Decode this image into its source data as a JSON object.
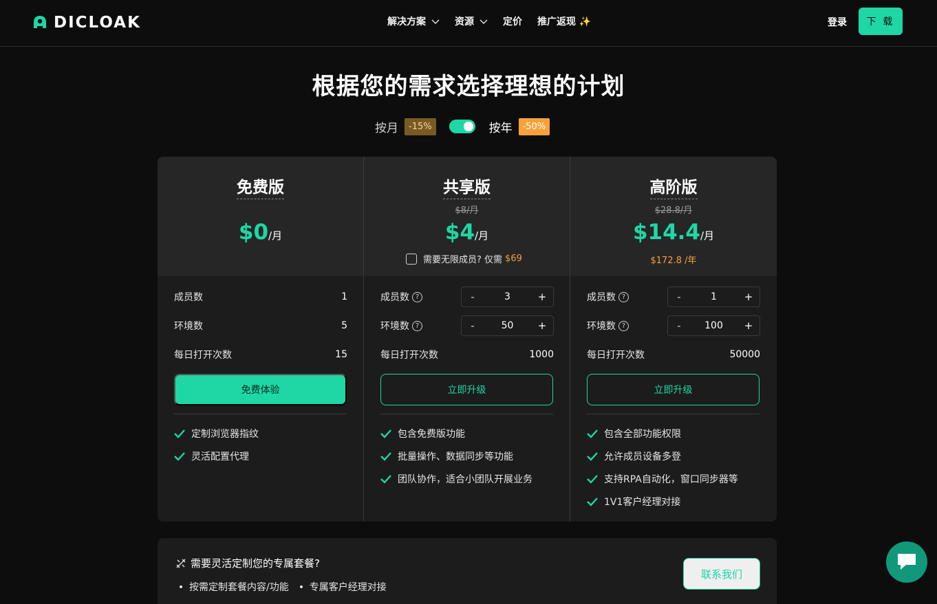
{
  "brand": {
    "name": "DICLOAK",
    "accent": "#1ed7a5",
    "orange": "#f8a13a"
  },
  "nav": {
    "items": [
      {
        "label": "解决方案",
        "has_dropdown": true
      },
      {
        "label": "资源",
        "has_dropdown": true
      },
      {
        "label": "定价",
        "has_dropdown": false
      },
      {
        "label": "推广返现 ✨",
        "has_dropdown": false
      }
    ],
    "login": "登录",
    "download": "下 载"
  },
  "title": "根据您的需求选择理想的计划",
  "billing": {
    "monthly_label": "按月",
    "monthly_badge": "-15%",
    "yearly_label": "按年",
    "yearly_badge": "-50%",
    "yearly_selected": true
  },
  "plans": [
    {
      "name": "免费版",
      "old_price": "",
      "price": "$0",
      "per": "/月",
      "members_label": "成员数",
      "members": "1",
      "envs_label": "环境数",
      "envs": "5",
      "opens_label": "每日打开次数",
      "opens": "15",
      "cta": "免费体验",
      "features": [
        "定制浏览器指纹",
        "灵活配置代理"
      ]
    },
    {
      "name": "共享版",
      "old_price": "$8/月",
      "price": "$4",
      "per": "/月",
      "unlimited_text": "需要无限成员? 仅需",
      "unlimited_price": "$69",
      "members_label": "成员数",
      "members": "3",
      "envs_label": "环境数",
      "envs": "50",
      "opens_label": "每日打开次数",
      "opens": "1000",
      "cta": "立即升级",
      "features": [
        "包含免费版功能",
        "批量操作、数据同步等功能",
        "团队协作，适合小团队开展业务"
      ]
    },
    {
      "name": "高阶版",
      "old_price": "$28.8/月",
      "price": "$14.4",
      "per": "/月",
      "yearly_price": "$172.8 /年",
      "members_label": "成员数",
      "members": "1",
      "envs_label": "环境数",
      "envs": "100",
      "opens_label": "每日打开次数",
      "opens": "50000",
      "cta": "立即升级",
      "features": [
        "包含全部功能权限",
        "允许成员设备多登",
        "支持RPA自动化，窗口同步器等",
        "1V1客户经理对接"
      ]
    }
  ],
  "stepper": {
    "minus": "-",
    "plus": "+"
  },
  "custom": {
    "title": "需要灵活定制您的专属套餐?",
    "bullets": [
      "按需定制套餐内容/功能",
      "专属客户经理对接"
    ],
    "contact": "联系我们"
  }
}
